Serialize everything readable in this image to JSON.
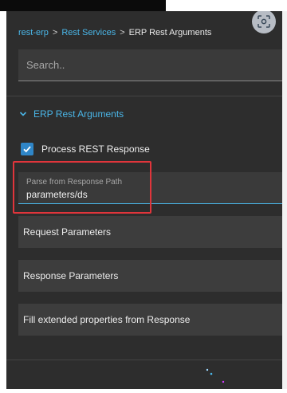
{
  "breadcrumb": {
    "items": [
      "rest-erp",
      "Rest Services"
    ],
    "separator": ">",
    "current": "ERP Rest Arguments"
  },
  "search": {
    "placeholder": "Search.."
  },
  "section": {
    "title": "ERP Rest Arguments",
    "expanded": true
  },
  "checkbox": {
    "label": "Process REST Response",
    "checked": true
  },
  "field": {
    "label": "Parse from Response Path",
    "value": "parameters/ds"
  },
  "accordions": [
    "Request Parameters",
    "Response Parameters",
    "Fill extended properties from Response"
  ],
  "colors": {
    "panel_bg": "#2d2d2d",
    "accent": "#4ab6e8",
    "checkbox": "#2f86c8",
    "highlight": "#e0353b"
  },
  "icons": [
    "screenshot-icon",
    "chevron-down-icon",
    "checkmark-icon"
  ]
}
